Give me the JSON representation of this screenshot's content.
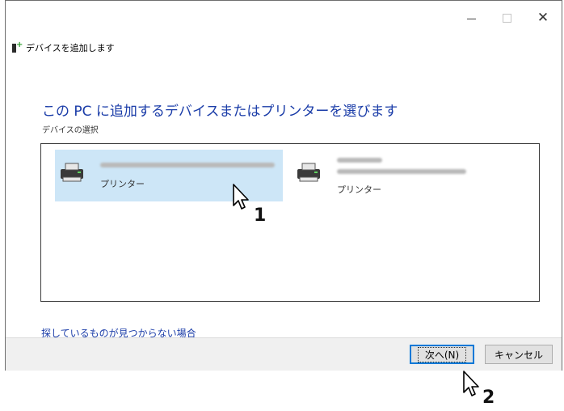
{
  "window": {
    "minimize_glyph": "–",
    "close_glyph": "✕"
  },
  "wizard": {
    "header": "デバイスを追加します",
    "title": "この PC に追加するデバイスまたはプリンターを選びます",
    "subtitle": "デバイスの選択"
  },
  "devices": [
    {
      "type": "プリンター",
      "selected": true,
      "icon": "printer-icon"
    },
    {
      "type": "プリンター",
      "selected": false,
      "icon": "printer-icon"
    }
  ],
  "help_link": "探しているものが見つからない場合",
  "buttons": {
    "next": "次へ(N)",
    "cancel": "キャンセル"
  },
  "annotations": {
    "step1": "1",
    "step2": "2"
  },
  "colors": {
    "accent": "#1a3ca8",
    "selection": "#cde6f7",
    "focus_border": "#0078d7"
  }
}
